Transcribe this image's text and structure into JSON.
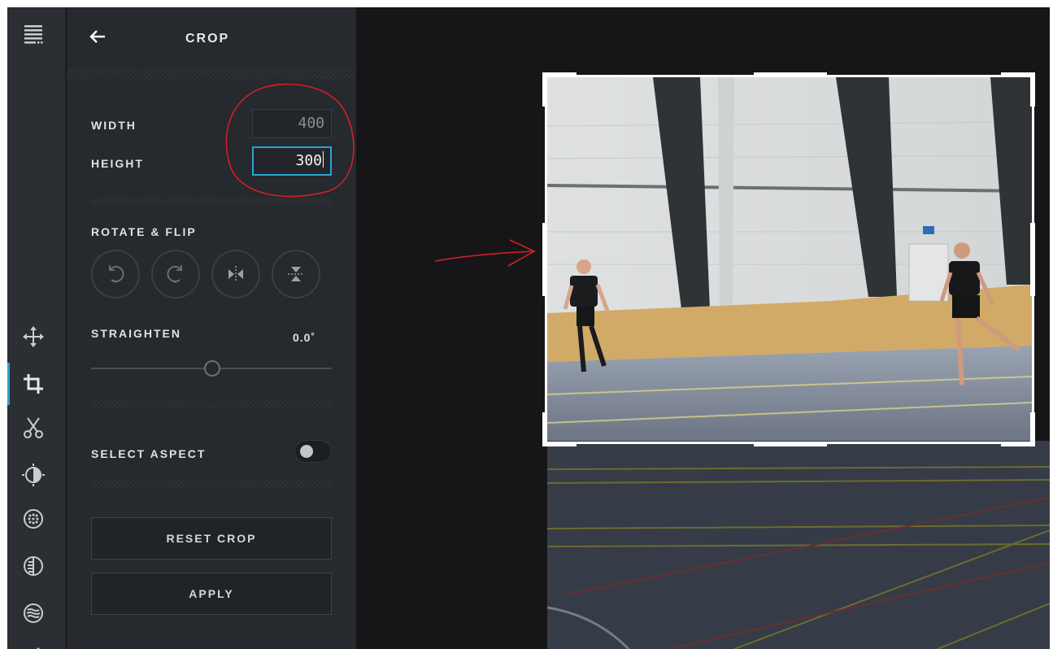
{
  "panel": {
    "title": "CROP",
    "width_label": "WIDTH",
    "width_value": "400",
    "height_label": "HEIGHT",
    "height_value": "300",
    "rotate_label": "ROTATE & FLIP",
    "rotate_buttons": [
      "rotate-left-icon",
      "rotate-right-icon",
      "flip-horizontal-icon",
      "flip-vertical-icon"
    ],
    "straighten_label": "STRAIGHTEN",
    "straighten_value": "0.0˚",
    "straighten_level": 0.5,
    "aspect_label": "SELECT ASPECT",
    "aspect_enabled": false,
    "reset_label": "RESET CROP",
    "apply_label": "APPLY"
  },
  "rail": {
    "icons": [
      "menu-icon",
      "move-icon",
      "crop-icon",
      "scissors-icon",
      "brightness-icon",
      "texture-icon",
      "vignette-icon",
      "waves-icon"
    ],
    "active": "crop-icon"
  },
  "colors": {
    "accent": "#27a6cf",
    "panel_bg": "#26292d",
    "rail_bg": "#2b2e32",
    "canvas_bg": "#161618",
    "annotation": "#d11f2a"
  }
}
